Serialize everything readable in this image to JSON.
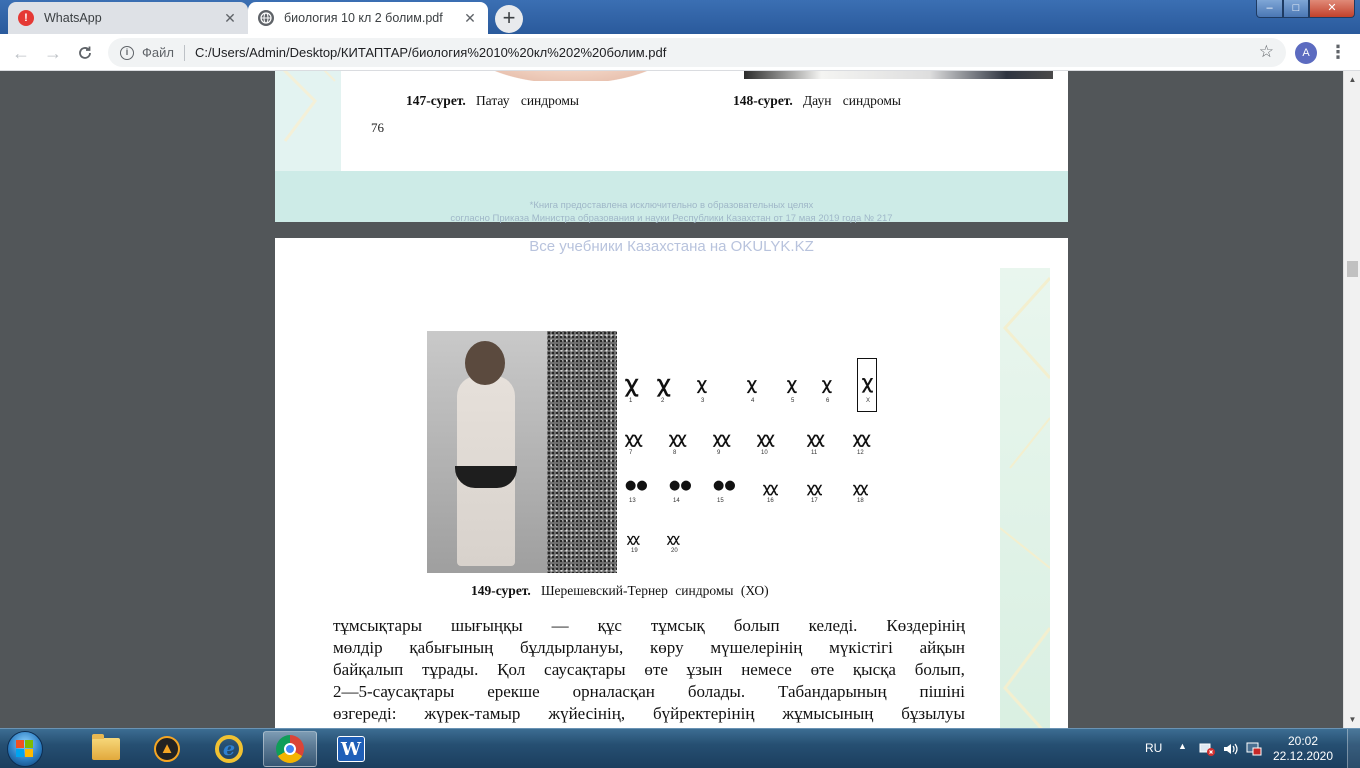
{
  "browser": {
    "tabs": [
      {
        "title": "WhatsApp",
        "favicon": "whatsapp-alert-icon",
        "active": false
      },
      {
        "title": "биология 10 кл 2 болим.pdf",
        "favicon": "globe-icon",
        "active": true
      }
    ],
    "new_tab_label": "+",
    "window_controls": {
      "minimize": "–",
      "maximize": "□",
      "close": "✕"
    },
    "address": {
      "scheme_label": "Файл",
      "url": "C:/Users/Admin/Desktop/КИТАПТАР/биология%2010%20кл%202%20болим.pdf"
    },
    "profile_initial": "A"
  },
  "pdf": {
    "page_prev": {
      "caption_left_num": "147-сурет.",
      "caption_left_text": "Патау синдромы",
      "caption_right_num": "148-сурет.",
      "caption_right_text": "Даун синдромы",
      "page_number": "76",
      "footer_line1": "*Книга предоставлена исключительно в образовательных целях",
      "footer_line2": "согласно Приказа Министра образования и науки Республики Казахстан от 17 мая 2019 года № 217"
    },
    "page_current": {
      "watermark": "Все учебники Казахстана на OKULYK.KZ",
      "figure_caption_num": "149-сурет.",
      "figure_caption_text": "Шерешевский-Тернер синдромы (ХО)",
      "chromosome_labels": [
        "1",
        "2",
        "3",
        "4",
        "5",
        "6",
        "X",
        "7",
        "8",
        "9",
        "10",
        "11",
        "12",
        "13",
        "14",
        "15",
        "16",
        "17",
        "18",
        "19",
        "20"
      ],
      "body_lines": [
        "тұмсықтары шығыңқы — құс тұмсық болып келеді. Көздерінің",
        "мөлдір қабығының бұлдырлануы, көру мүшелерінің мүкістігі айқын",
        "байқалып тұрады. Қол саусақтары өте ұзын немесе өте қысқа болып,",
        "2—5-саусақтары ерекше орналасқан болады. Табандарының пішіні",
        "өзгереді: жүрек-тамыр жүйесінің, бүйректерінің жұмысының бұзылуы"
      ]
    }
  },
  "taskbar": {
    "language": "RU",
    "time": "20:02",
    "date": "22.12.2020",
    "apps": [
      "explorer-folder-icon",
      "aimp-icon",
      "internet-explorer-icon",
      "chrome-icon",
      "word-icon"
    ]
  }
}
